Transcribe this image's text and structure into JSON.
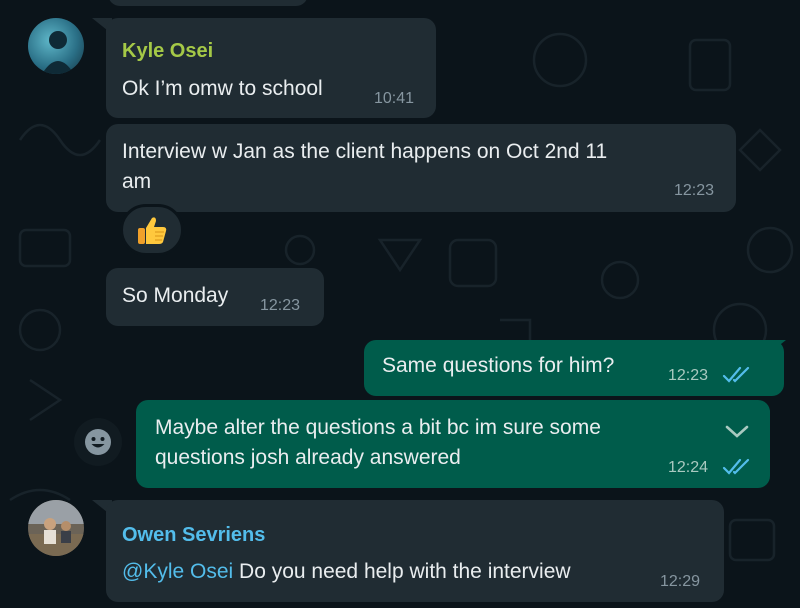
{
  "messages": [
    {
      "sender": "Kyle Osei",
      "text": "Ok I’m omw to school",
      "time": "10:41"
    },
    {
      "text_line1": "Interview w Jan as the client happens on Oct 2nd 11",
      "text_line2": "am",
      "time": "12:23",
      "reaction": "👍"
    },
    {
      "text": "So Monday",
      "time": "12:23"
    },
    {
      "text": "Same questions for him?",
      "time": "12:23",
      "status": "read"
    },
    {
      "text_line1": "Maybe alter the questions a bit bc im sure some",
      "text_line2": "questions josh already answered",
      "time": "12:24",
      "status": "read"
    },
    {
      "sender": "Owen Sevriens",
      "mention": "@Kyle Osei",
      "text": " Do you need help with the interview",
      "time": "12:29"
    }
  ],
  "colors": {
    "background": "#0b141a",
    "incoming": "#202c33",
    "outgoing": "#005c4b",
    "kyle_name": "#a5c947",
    "owen_name": "#53bdeb",
    "mention": "#53bdeb",
    "read_ticks": "#53bdeb"
  },
  "icons": [
    "double-check-icon",
    "chevron-down-icon",
    "smiley-icon",
    "thumbs-up-emoji"
  ]
}
